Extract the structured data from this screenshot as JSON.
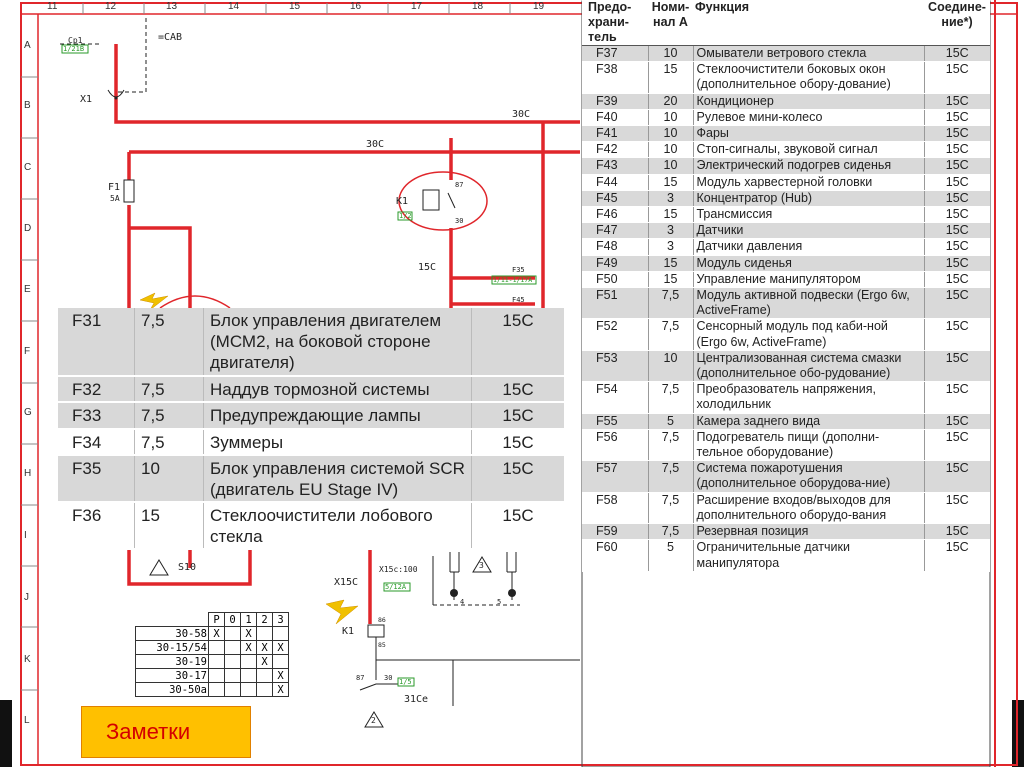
{
  "column_numbers": [
    "11",
    "12",
    "13",
    "14",
    "15",
    "16",
    "17",
    "18",
    "19"
  ],
  "row_letters": [
    "A",
    "B",
    "C",
    "D",
    "E",
    "F",
    "G",
    "H",
    "I",
    "J",
    "K",
    "L"
  ],
  "schematic": {
    "cab_label": "=CAB",
    "x1_label": "X1",
    "cp1_label": "Cp1",
    "cp1_code": "1/21B",
    "wire_30c_top": "30C",
    "wire_30c_mid": "30C",
    "f1_label": "F1",
    "f1_rating": "5A",
    "k1_label": "K1",
    "k1_pin_87": "87",
    "k1_pin_30": "30",
    "k1_code": "1/2",
    "wire_15c": "15C",
    "f35_ref": "F35",
    "f35_code": "1/11-1/17A",
    "f45_ref": "F45",
    "s10_label": "S10",
    "x15c_label": "X15C",
    "x15c_ref": "X15c:100",
    "x15c_code": "5/12A",
    "k1_lower_label": "K1",
    "k1_lower_pin_86": "86",
    "k1_lower_pin_85": "85",
    "contact_87": "87",
    "contact_30": "30",
    "contact_code": "1/5",
    "wire_31ce": "31Ce",
    "warn_2": "2",
    "warn_3": "3",
    "pin_4": "4",
    "pin_5": "5",
    "switch_grid": {
      "headers": [
        "P",
        "0",
        "1",
        "2",
        "3"
      ],
      "rows": [
        {
          "label": "30-58",
          "marks": [
            "X",
            "",
            "X",
            "",
            ""
          ]
        },
        {
          "label": "30-15/54",
          "marks": [
            "",
            "",
            "X",
            "X",
            "X"
          ]
        },
        {
          "label": "30-19",
          "marks": [
            "",
            "",
            "",
            "X",
            ""
          ]
        },
        {
          "label": "30-17",
          "marks": [
            "",
            "",
            "",
            "",
            "X"
          ]
        },
        {
          "label": "30-50a",
          "marks": [
            "",
            "",
            "",
            "",
            "X"
          ]
        }
      ]
    }
  },
  "left_table": [
    {
      "fuse": "F31",
      "rating": "7,5",
      "function": "Блок управления двигателем (МСМ2, на боковой стороне двигателя)",
      "conn": "15C",
      "shade": true
    },
    {
      "fuse": "F32",
      "rating": "7,5",
      "function": "Наддув тормозной системы",
      "conn": "15C",
      "shade": true
    },
    {
      "fuse": "F33",
      "rating": "7,5",
      "function": "Предупреждающие лампы",
      "conn": "15C",
      "shade": true
    },
    {
      "fuse": "F34",
      "rating": "7,5",
      "function": "Зуммеры",
      "conn": "15C",
      "shade": false
    },
    {
      "fuse": "F35",
      "rating": "10",
      "function": "Блок управления системой SCR (двигатель EU Stage IV)",
      "conn": "15C",
      "shade": true
    },
    {
      "fuse": "F36",
      "rating": "15",
      "function": "Стеклоочистители лобового стекла",
      "conn": "15C",
      "shade": false
    }
  ],
  "right_table": {
    "headers": {
      "holder": "Предо-храни-тель",
      "rating": "Номи-нал А",
      "function": "Функция",
      "conn": "Соедине-ние*)"
    },
    "rows": [
      {
        "fuse": "F37",
        "rating": "10",
        "function": "Омыватели ветрового стекла",
        "conn": "15C",
        "shade": true
      },
      {
        "fuse": "F38",
        "rating": "15",
        "function": "Стеклоочистители боковых окон (дополнительное обору-дование)",
        "conn": "15C",
        "shade": false
      },
      {
        "fuse": "F39",
        "rating": "20",
        "function": "Кондиционер",
        "conn": "15C",
        "shade": true
      },
      {
        "fuse": "F40",
        "rating": "10",
        "function": "Рулевое мини-колесо",
        "conn": "15C",
        "shade": false
      },
      {
        "fuse": "F41",
        "rating": "10",
        "function": "Фары",
        "conn": "15C",
        "shade": true
      },
      {
        "fuse": "F42",
        "rating": "10",
        "function": "Стоп-сигналы, звуковой сигнал",
        "conn": "15C",
        "shade": false
      },
      {
        "fuse": "F43",
        "rating": "10",
        "function": "Электрический подогрев сиденья",
        "conn": "15C",
        "shade": true
      },
      {
        "fuse": "F44",
        "rating": "15",
        "function": "Модуль харвестерной головки",
        "conn": "15C",
        "shade": false
      },
      {
        "fuse": "F45",
        "rating": "3",
        "function": "Концентратор (Hub)",
        "conn": "15C",
        "shade": true
      },
      {
        "fuse": "F46",
        "rating": "15",
        "function": "Трансмиссия",
        "conn": "15C",
        "shade": false
      },
      {
        "fuse": "F47",
        "rating": "3",
        "function": "Датчики",
        "conn": "15C",
        "shade": true
      },
      {
        "fuse": "F48",
        "rating": "3",
        "function": "Датчики давления",
        "conn": "15C",
        "shade": false
      },
      {
        "fuse": "F49",
        "rating": "15",
        "function": "Модуль сиденья",
        "conn": "15C",
        "shade": true
      },
      {
        "fuse": "F50",
        "rating": "15",
        "function": "Управление манипулятором",
        "conn": "15C",
        "shade": false
      },
      {
        "fuse": "F51",
        "rating": "7,5",
        "function": "Модуль активной подвески (Ergo 6w, ActiveFrame)",
        "conn": "15C",
        "shade": true
      },
      {
        "fuse": "F52",
        "rating": "7,5",
        "function": "Сенсорный модуль под каби-ной (Ergo 6w, ActiveFrame)",
        "conn": "15C",
        "shade": false
      },
      {
        "fuse": "F53",
        "rating": "10",
        "function": "Централизованная система смазки (дополнительное обо-рудование)",
        "conn": "15C",
        "shade": true
      },
      {
        "fuse": "F54",
        "rating": "7,5",
        "function": "Преобразователь напряжения, холодильник",
        "conn": "15C",
        "shade": false
      },
      {
        "fuse": "F55",
        "rating": "5",
        "function": "Камера заднего вида",
        "conn": "15C",
        "shade": true
      },
      {
        "fuse": "F56",
        "rating": "7,5",
        "function": "Подогреватель пищи (дополни-тельное оборудование)",
        "conn": "15C",
        "shade": false
      },
      {
        "fuse": "F57",
        "rating": "7,5",
        "function": "Система пожаротушения (дополнительное оборудова-ние)",
        "conn": "15C",
        "shade": true
      },
      {
        "fuse": "F58",
        "rating": "7,5",
        "function": "Расширение входов/выходов для дополнительного оборудо-вания",
        "conn": "15C",
        "shade": false
      },
      {
        "fuse": "F59",
        "rating": "7,5",
        "function": "Резервная позиция",
        "conn": "15C",
        "shade": true
      },
      {
        "fuse": "F60",
        "rating": "5",
        "function": "Ограничительные датчики манипулятора",
        "conn": "15C",
        "shade": false
      }
    ]
  },
  "notes_button": "Заметки",
  "colors": {
    "wire": "#e0262b",
    "accent_border": "#e0262b",
    "code_green": "#2a9a2a",
    "notes_bg": "#ffc000",
    "notes_text": "#d40000"
  }
}
